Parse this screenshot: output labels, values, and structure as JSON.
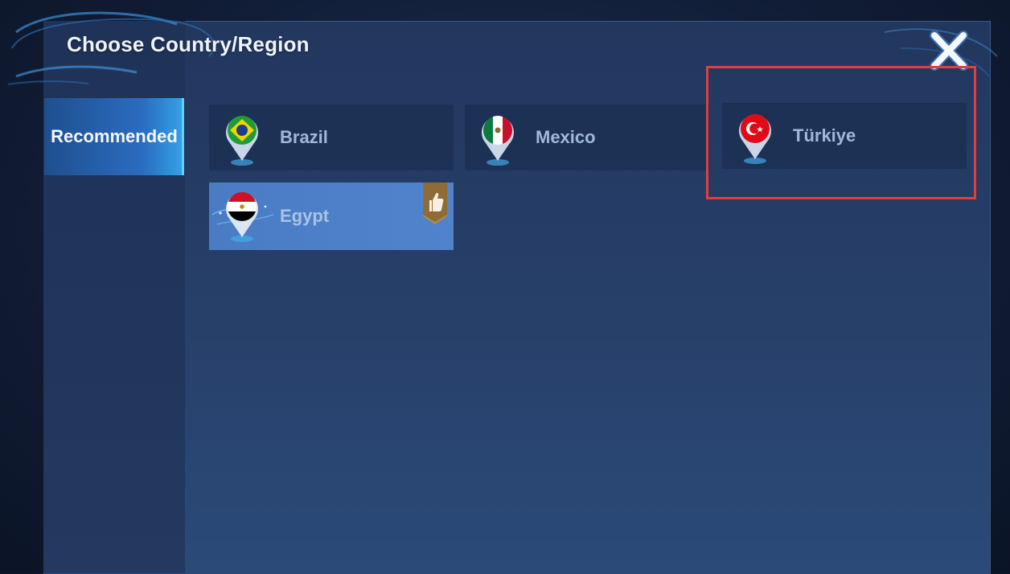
{
  "window": {
    "title": "Choose Country/Region"
  },
  "sidebar": {
    "tabs": [
      {
        "label": "Recommended",
        "active": true
      }
    ]
  },
  "countries": [
    {
      "name": "Brazil",
      "flag": "brazil-flag-icon"
    },
    {
      "name": "Mexico",
      "flag": "mexico-flag-icon"
    },
    {
      "name": "Türkiye",
      "flag": "turkey-flag-icon",
      "highlighted": true
    },
    {
      "name": "Egypt",
      "flag": "egypt-flag-icon",
      "selected": true,
      "recommended_badge": "thumbs-up-icon"
    }
  ],
  "colors": {
    "highlight": "#e53c3c",
    "accent": "#35a2e8",
    "badge": "#b08a4e"
  }
}
